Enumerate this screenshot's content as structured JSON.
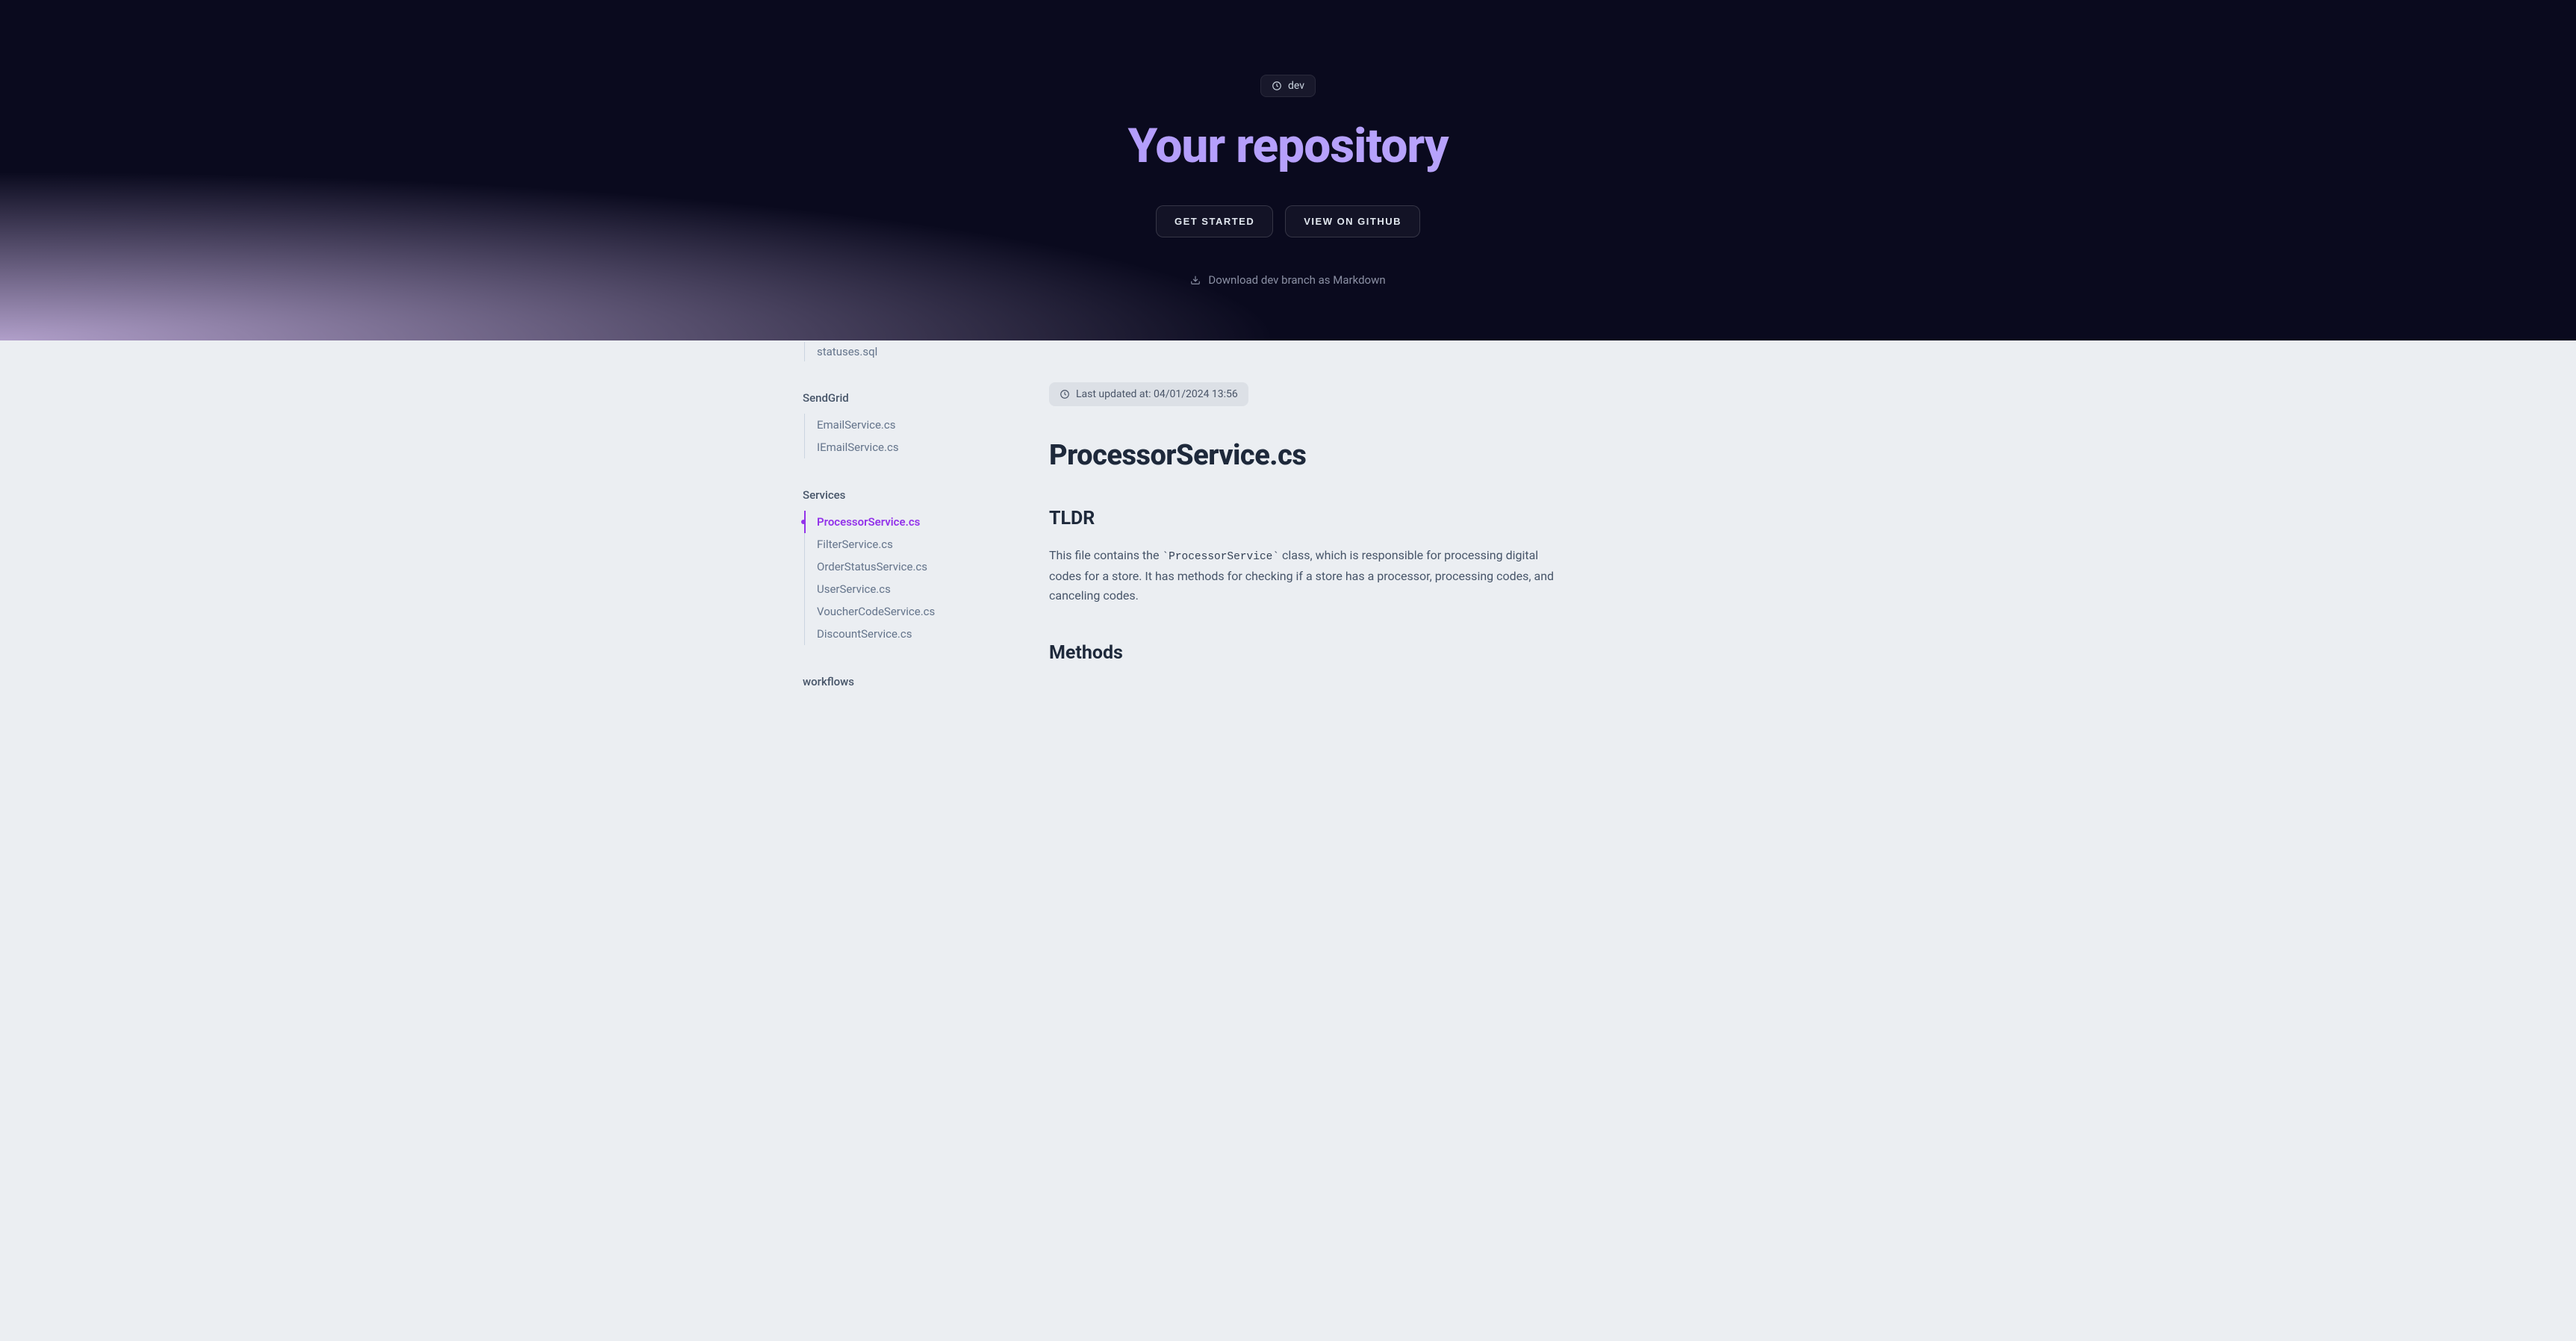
{
  "hero": {
    "branch": "dev",
    "title": "Your repository",
    "get_started": "GET STARTED",
    "view_github": "VIEW ON GITHUB",
    "download_text": "Download dev branch as Markdown"
  },
  "sidebar": {
    "cut_item": "statuses.sql",
    "groups": [
      {
        "title": "SendGrid",
        "items": [
          {
            "label": "EmailService.cs",
            "active": false
          },
          {
            "label": "IEmailService.cs",
            "active": false
          }
        ]
      },
      {
        "title": "Services",
        "items": [
          {
            "label": "ProcessorService.cs",
            "active": true
          },
          {
            "label": "FilterService.cs",
            "active": false
          },
          {
            "label": "OrderStatusService.cs",
            "active": false
          },
          {
            "label": "UserService.cs",
            "active": false
          },
          {
            "label": "VoucherCodeService.cs",
            "active": false
          },
          {
            "label": "DiscountService.cs",
            "active": false
          }
        ]
      },
      {
        "title": "workflows",
        "items": []
      }
    ]
  },
  "main": {
    "last_updated": "Last updated at: 04/01/2024 13:56",
    "title": "ProcessorService.cs",
    "tldr_heading": "TLDR",
    "tldr_before": "This file contains the ",
    "tldr_code": "`ProcessorService`",
    "tldr_after": " class, which is responsible for processing digital codes for a store. It has methods for checking if a store has a processor, processing codes, and canceling codes.",
    "methods_heading": "Methods"
  }
}
